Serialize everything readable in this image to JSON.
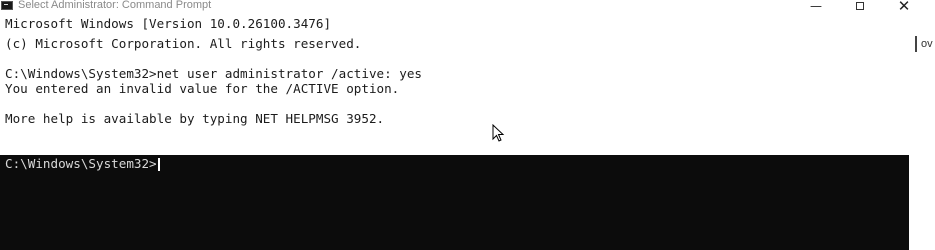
{
  "window": {
    "title": "Select Administrator: Command Prompt",
    "icon": "cmd-icon",
    "controls": {
      "minimize": "—",
      "close": "✕"
    }
  },
  "console": {
    "lines": [
      "Microsoft Windows [Version 10.0.26100.3476]",
      "(c) Microsoft Corporation. All rights reserved.",
      "C:\\Windows\\System32>net user administrator /active: yes",
      "You entered an invalid value for the /ACTIVE option.",
      "More help is available by typing NET HELPMSG 3952."
    ],
    "prompt": "C:\\Windows\\System32>"
  },
  "background_window": {
    "fragment": "ov"
  },
  "colors": {
    "selection_bg": "#0c0c0c",
    "console_text": "#1c1c1c",
    "title_text": "#8a8a8a"
  }
}
